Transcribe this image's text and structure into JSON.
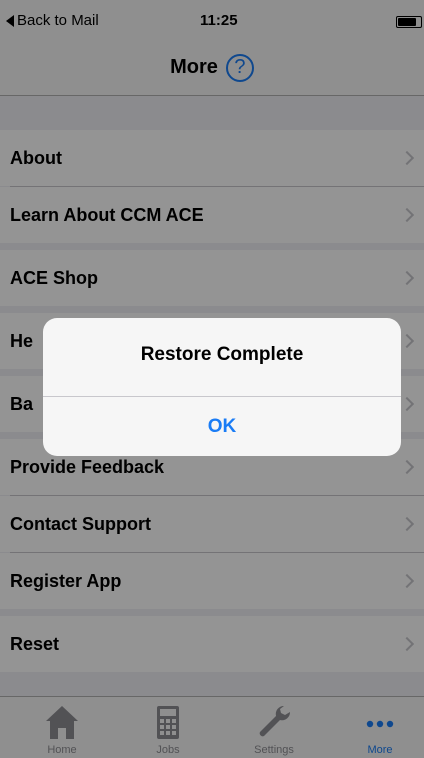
{
  "status_bar": {
    "back_label": "Back to Mail",
    "time": "11:25",
    "battery_level": 0.75
  },
  "nav": {
    "title": "More",
    "help_glyph": "?"
  },
  "menu": {
    "items": [
      {
        "label": "About"
      },
      {
        "label": "Learn About CCM ACE"
      },
      {
        "label": "ACE Shop"
      },
      {
        "label": "He"
      },
      {
        "label": "Ba"
      },
      {
        "label": "Provide Feedback"
      },
      {
        "label": "Contact Support"
      },
      {
        "label": "Register App"
      },
      {
        "label": "Reset"
      }
    ]
  },
  "tabbar": {
    "tabs": [
      {
        "label": "Home",
        "icon": "house-icon"
      },
      {
        "label": "Jobs",
        "icon": "calculator-icon"
      },
      {
        "label": "Settings",
        "icon": "wrench-icon"
      },
      {
        "label": "More",
        "icon": "more-dots-icon",
        "active": true
      }
    ]
  },
  "alert": {
    "title": "Restore Complete",
    "ok_label": "OK"
  },
  "colors": {
    "accent": "#1a7cf5",
    "background": "#efeff4",
    "row": "#ffffff",
    "separator": "#c8c7cc"
  }
}
